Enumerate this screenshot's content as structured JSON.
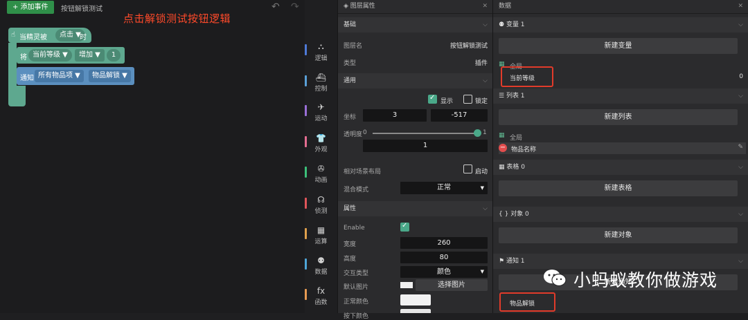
{
  "workspace": {
    "add_event": "+ 添加事件",
    "title": "按钮解锁测试",
    "annotation": "点击解锁测试按钮逻辑",
    "hat": {
      "prefix": "当精灵被",
      "event": "点击 ▼",
      "suffix": "时"
    },
    "set_block": {
      "prefix": "将",
      "var": "当前等级 ▼",
      "op": "增加 ▼",
      "num": "1"
    },
    "notify_block": {
      "prefix": "通知",
      "target": "所有物品项 ▼",
      "msg": "物品解锁 ▼"
    }
  },
  "categories": [
    {
      "label": "逻辑",
      "icon": "⛬",
      "color": "#4e7ad8"
    },
    {
      "label": "控制",
      "icon": "⛴",
      "color": "#5aa0d8"
    },
    {
      "label": "运动",
      "icon": "✈",
      "color": "#9a6fd8"
    },
    {
      "label": "外观",
      "icon": "👕",
      "color": "#e46d91"
    },
    {
      "label": "动画",
      "icon": "✇",
      "color": "#3cc07a"
    },
    {
      "label": "侦测",
      "icon": "☊",
      "color": "#e0555a"
    },
    {
      "label": "运算",
      "icon": "▦",
      "color": "#e0a04c"
    },
    {
      "label": "数据",
      "icon": "⚉",
      "color": "#4ea6d8"
    },
    {
      "label": "函数",
      "icon": "fx",
      "color": "#e79a52"
    }
  ],
  "layer_panel": {
    "title": "图层属性",
    "basic": {
      "header": "基础",
      "name_label": "图层名",
      "name_value": "按钮解锁测试",
      "type_label": "类型",
      "type_value": "插件"
    },
    "general": {
      "header": "通用",
      "visible_label": "显示",
      "lock_label": "锁定",
      "coord_label": "坐标",
      "x": "3",
      "y": "-517",
      "opacity_label": "透明度",
      "opacity_min": "0",
      "opacity_max": "1",
      "opacity_value": "1",
      "opacity_fraction": 1.0,
      "relative_label": "相对场景布局",
      "enable_label": "启动",
      "blend_label": "混合模式",
      "blend_value": "正常"
    },
    "props": {
      "header": "属性",
      "enable_label": "Enable",
      "width_label": "宽度",
      "width_value": "260",
      "height_label": "高度",
      "height_value": "80",
      "interaction_label": "交互类型",
      "interaction_value": "颜色",
      "default_image_label": "默认图片",
      "choose_image": "选择图片",
      "normal_color_label": "正常颜色",
      "pressed_color_label": "按下颜色"
    }
  },
  "data_panel": {
    "title": "数据",
    "var": {
      "header": "变量 1",
      "new_btn": "新建变量",
      "scope": "全局",
      "item_name": "当前等级",
      "item_value": "0"
    },
    "list": {
      "header": "列表 1",
      "new_btn": "新建列表",
      "scope": "全局",
      "item_name": "物品名称"
    },
    "table": {
      "header": "表格 0",
      "new_btn": "新建表格"
    },
    "object": {
      "header": "对象 0",
      "new_btn": "新建对象"
    },
    "notify": {
      "header": "通知 1",
      "new_btn": "新建通知",
      "item_name": "物品解锁"
    }
  },
  "watermark": "小蚂蚁教你做游戏",
  "colors": {
    "accent": "#5ea88f",
    "annotation": "#ff4a2a",
    "highlight": "#e23b2a"
  }
}
